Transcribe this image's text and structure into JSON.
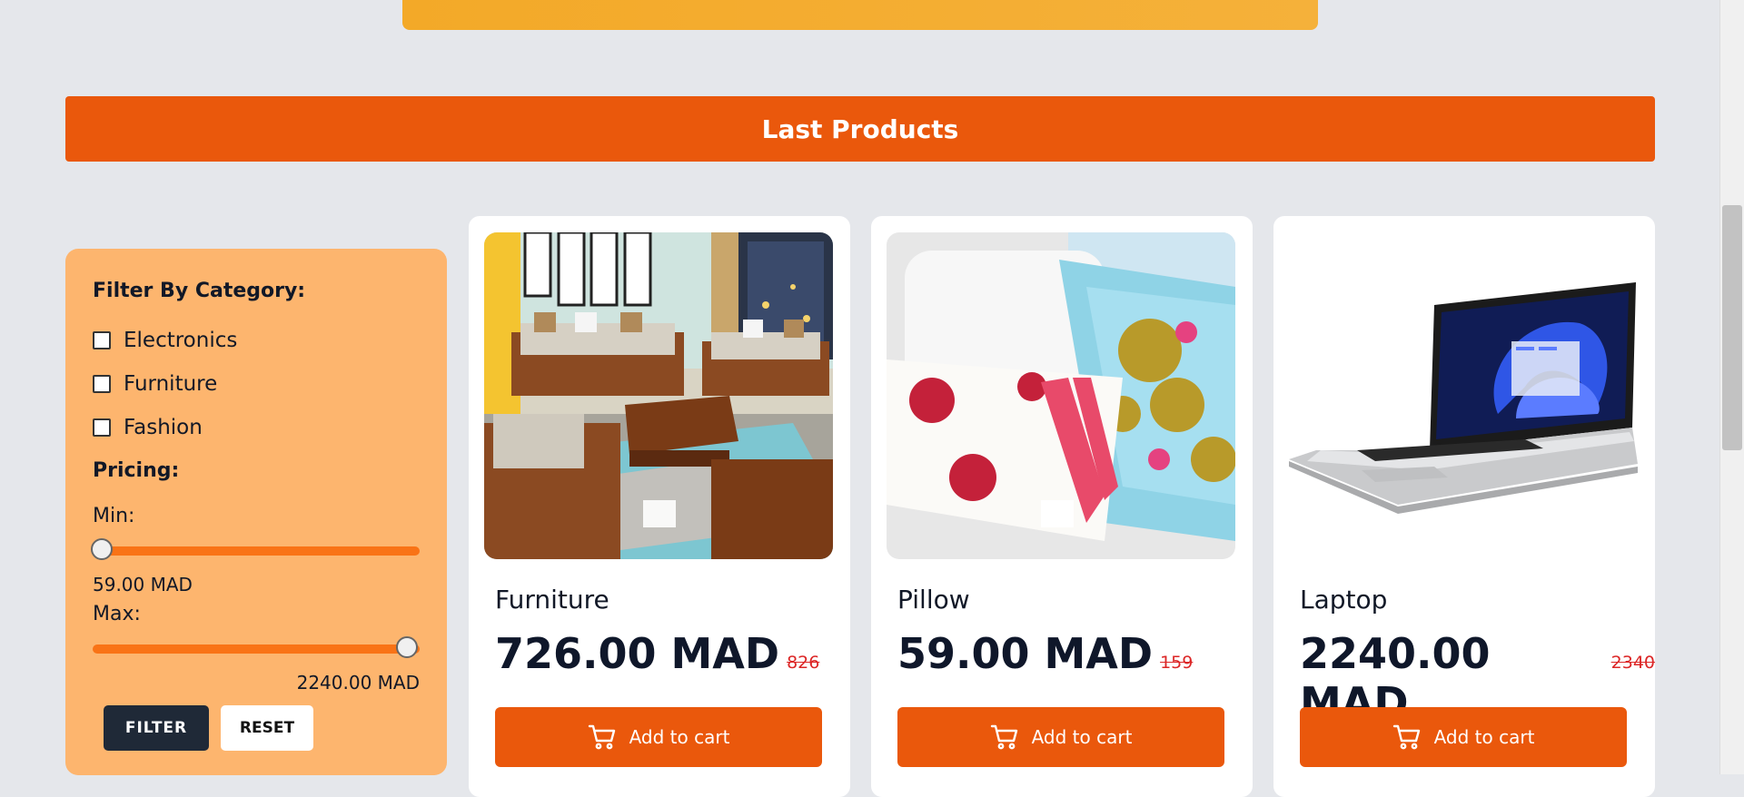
{
  "section": {
    "title": "Last Products"
  },
  "filter": {
    "category_title": "Filter By Category:",
    "categories": [
      {
        "label": "Electronics",
        "checked": false
      },
      {
        "label": "Furniture",
        "checked": false
      },
      {
        "label": "Fashion",
        "checked": false
      }
    ],
    "pricing_title": "Pricing:",
    "min_label": "Min:",
    "min_value": "59.00 MAD",
    "max_label": "Max:",
    "max_value": "2240.00 MAD",
    "filter_button": "FILTER",
    "reset_button": "RESET"
  },
  "products": [
    {
      "name": "Furniture",
      "price": "726.00 MAD",
      "old_price": "826",
      "button": "Add to cart",
      "image": "living-room-sofa-set"
    },
    {
      "name": "Pillow",
      "price": "59.00 MAD",
      "old_price": "159",
      "button": "Add to cart",
      "image": "decorative-pillows"
    },
    {
      "name": "Laptop",
      "price": "2240.00 MAD",
      "old_price": "2340",
      "button": "Add to cart",
      "image": "laptop"
    }
  ],
  "colors": {
    "accent": "#ea580c",
    "filter_panel": "#fdb56e",
    "banner": "#f3a928",
    "page_bg": "#e5e7eb",
    "old_price": "#dc2626"
  }
}
